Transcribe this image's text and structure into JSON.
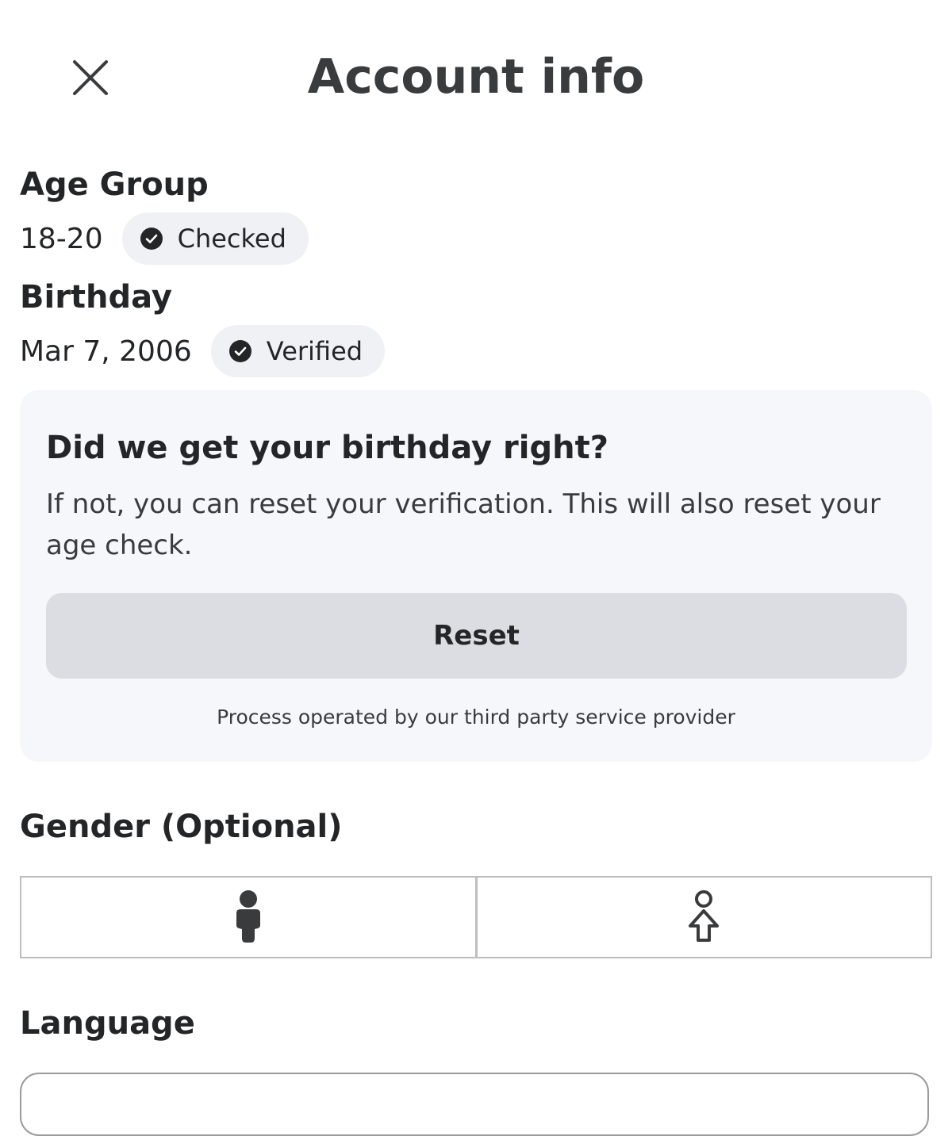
{
  "header": {
    "title": "Account info"
  },
  "age_group": {
    "label": "Age Group",
    "value": "18-20",
    "badge": "Checked"
  },
  "birthday": {
    "label": "Birthday",
    "value": "Mar 7, 2006",
    "badge": "Verified"
  },
  "verification_card": {
    "title": "Did we get your birthday right?",
    "description": "If not, you can reset your verification. This will also reset your age check.",
    "reset_label": "Reset",
    "note": "Process operated by our third party service provider"
  },
  "gender": {
    "label": "Gender (Optional)",
    "options": [
      {
        "icon": "male-icon"
      },
      {
        "icon": "female-icon"
      }
    ]
  },
  "language": {
    "label": "Language"
  },
  "colors": {
    "text_primary": "#232527",
    "text_secondary": "#393b3d",
    "badge_background": "#eff1f4",
    "card_background": "#f6f7fa",
    "button_background": "#dcdde3",
    "border": "#bdbebe"
  }
}
